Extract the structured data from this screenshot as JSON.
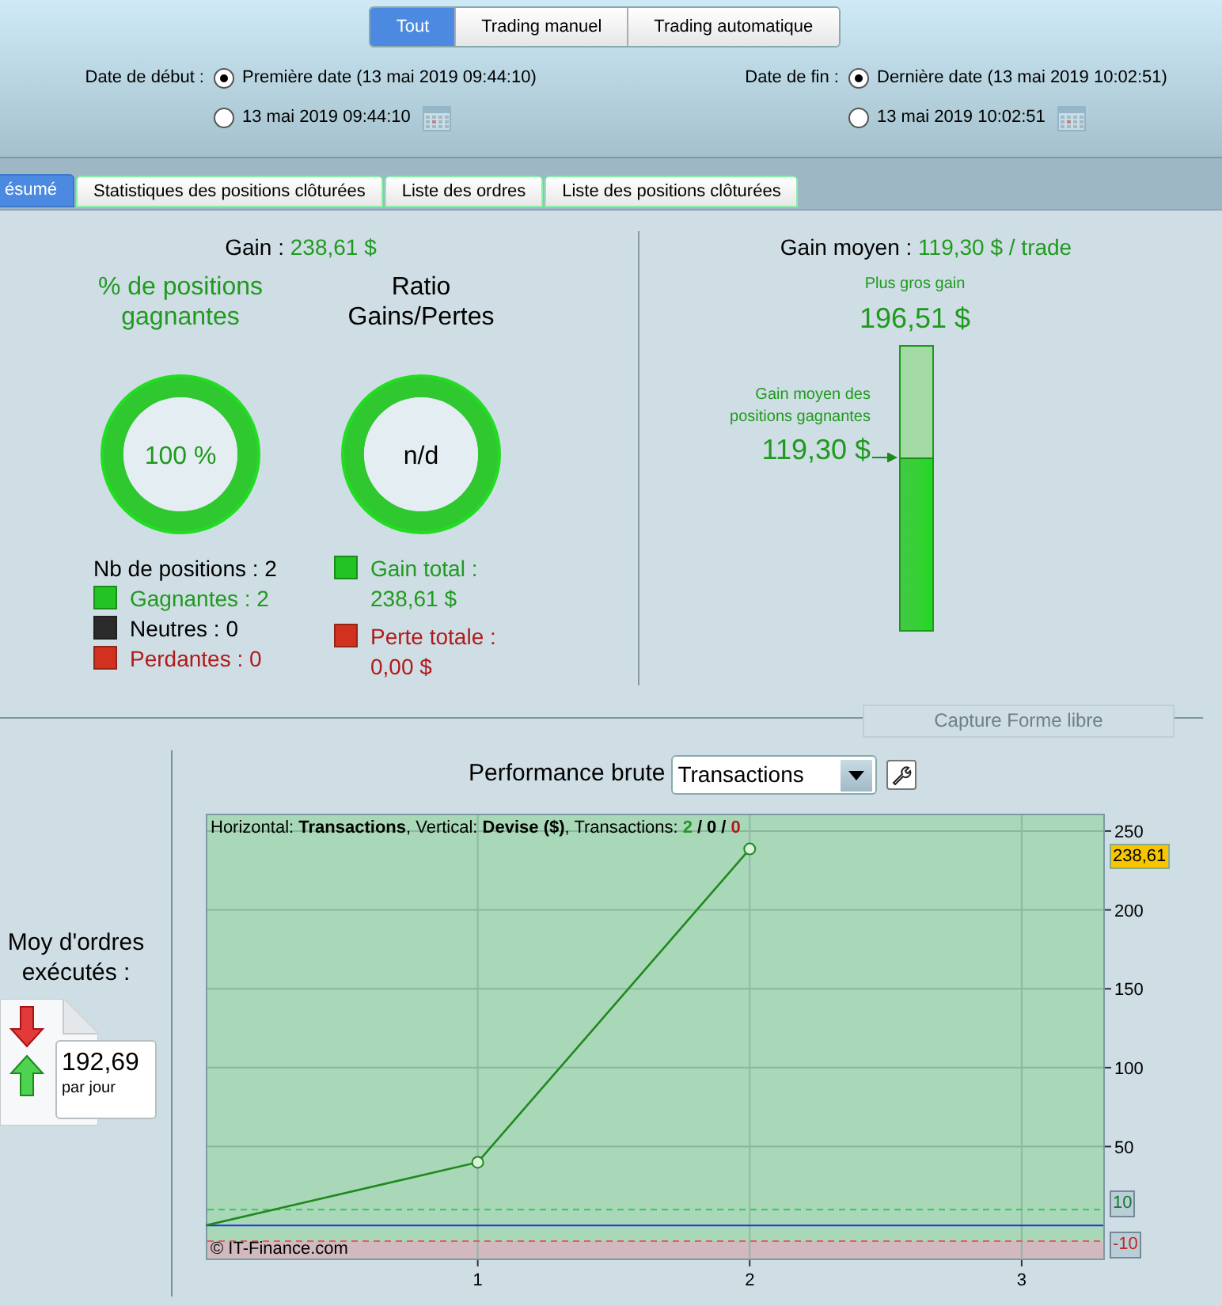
{
  "mode_buttons": [
    {
      "label": "Tout",
      "selected": true
    },
    {
      "label": "Trading manuel",
      "selected": false
    },
    {
      "label": "Trading automatique",
      "selected": false
    }
  ],
  "date_filters": [
    {
      "label": "Date de début :",
      "options": [
        {
          "kind": "preset",
          "text": "Première date (13 mai 2019 09:44:10)",
          "selected": true
        },
        {
          "kind": "custom",
          "text": "13 mai 2019 09:44:10",
          "selected": false
        }
      ]
    },
    {
      "label": "Date de fin :",
      "options": [
        {
          "kind": "preset",
          "text": "Dernière date (13 mai 2019 10:02:51)",
          "selected": true
        },
        {
          "kind": "custom",
          "text": "13 mai 2019 10:02:51",
          "selected": false
        }
      ]
    }
  ],
  "tabs": [
    {
      "label": "ésumé",
      "selected": true
    },
    {
      "label": "Statistiques des positions clôturées",
      "selected": false
    },
    {
      "label": "Liste des ordres",
      "selected": false
    },
    {
      "label": "Liste des positions clôturées",
      "selected": false
    }
  ],
  "gain": {
    "label": "Gain :",
    "value": "238,61 $"
  },
  "gauges": [
    {
      "kind": "win",
      "title": "% de positions gagnantes",
      "value": "100 %",
      "legend": [
        {
          "kind": "plain",
          "text": "Nb de positions : 2"
        },
        {
          "kind": "win",
          "color": "#22c322",
          "text": "Gagnantes : 2"
        },
        {
          "kind": "neutral",
          "color": "#2b2b2b",
          "text": "Neutres : 0"
        },
        {
          "kind": "loss",
          "color": "#d0321f",
          "text": "Perdantes : 0"
        }
      ]
    },
    {
      "kind": "neutral",
      "title": "Ratio Gains/Pertes",
      "value": "n/d",
      "legend": [
        {
          "kind": "win",
          "color": "#22c322",
          "text": "Gain total : 238,61 $"
        },
        {
          "kind": "loss",
          "color": "#d0321f",
          "text": "Perte totale : 0,00 $"
        }
      ]
    }
  ],
  "average_gain": {
    "label": "Gain moyen :",
    "value": "119,30 $ / trade",
    "max_label": "Plus gros gain",
    "max_value": "196,51 $",
    "marker_label": "Gain moyen des positions gagnantes",
    "marker_value": "119,30 $",
    "level": 0.607
  },
  "overlay_button": "Capture Forme libre",
  "orders": {
    "label": "Moy d'ordres exécutés :",
    "value": "192,69",
    "unit": "par jour"
  },
  "performance": {
    "title": "Performance brute",
    "select": "Transactions",
    "header": "Horizontal: **Transactions**, Vertical: **Devise ($)**, Transactions:",
    "counts": [
      {
        "kind": "win",
        "text": "2"
      },
      {
        "kind": "sep",
        "text": "/"
      },
      {
        "kind": "neutral",
        "text": "0"
      },
      {
        "kind": "sep",
        "text": "/"
      },
      {
        "kind": "loss",
        "text": "0"
      }
    ],
    "copyright": "© IT-Finance.com",
    "chart_data": {
      "type": "line",
      "x": [
        0,
        1,
        2
      ],
      "series": [
        {
          "color": "#1e8a1e",
          "values": [
            0,
            40,
            238.61
          ]
        }
      ],
      "xlim": [
        0,
        3.3
      ],
      "ylim": [
        -21,
        261
      ],
      "xticks": [
        1,
        2,
        3
      ],
      "yticks": [
        50,
        100,
        150,
        200,
        250
      ],
      "grid": true,
      "ref_lines": [
        {
          "axis": "y",
          "value": 10,
          "label": "10",
          "color": "#3ec45e"
        },
        {
          "axis": "y",
          "value": 0,
          "color": "#2233dd"
        },
        {
          "axis": "y",
          "value": -10,
          "label": "-10",
          "color": "#e06060"
        }
      ],
      "annotations": [
        "238,61"
      ]
    }
  }
}
